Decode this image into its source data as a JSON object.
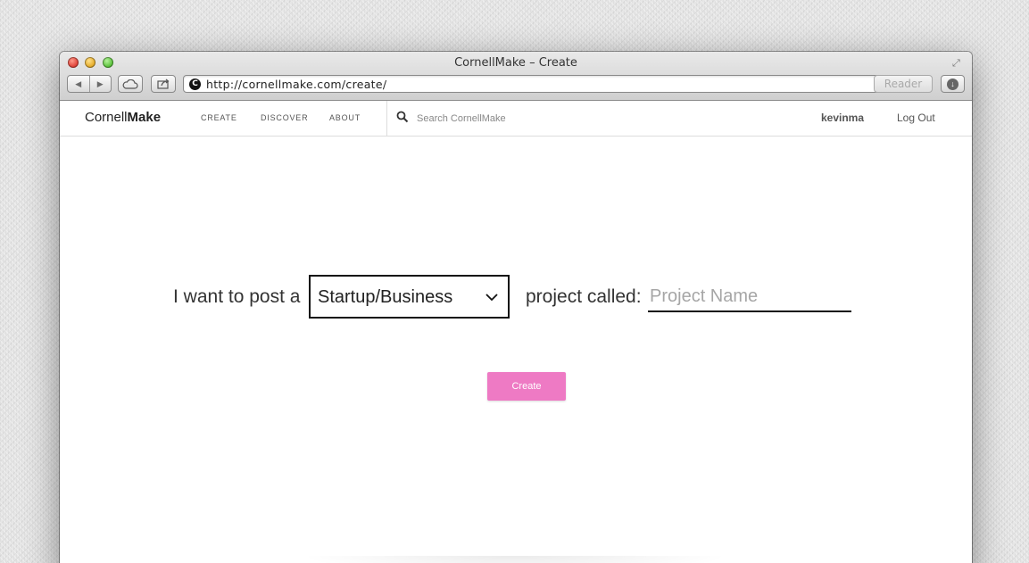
{
  "window": {
    "title": "CornellMake – Create"
  },
  "browser": {
    "url": "http://cornellmake.com/create/",
    "site_icon_letter": "C",
    "reader_label": "Reader",
    "icons": [
      "back-icon",
      "forward-icon",
      "cloud-icon",
      "share-icon",
      "reload-icon",
      "download-icon",
      "fullscreen-icon"
    ]
  },
  "nav": {
    "logo_regular": "Cornell",
    "logo_bold": "Make",
    "links": [
      "CREATE",
      "DISCOVER",
      "ABOUT"
    ],
    "search_placeholder": "Search CornellMake",
    "username": "kevinma",
    "logout": "Log Out"
  },
  "form": {
    "lead": "I want to post a",
    "category_selected": "Startup/Business",
    "called": "project called:",
    "name_placeholder": "Project Name",
    "name_value": "",
    "create_label": "Create"
  },
  "colors": {
    "accent": "#ee7ac4",
    "text": "#333333",
    "border": "#111111"
  }
}
